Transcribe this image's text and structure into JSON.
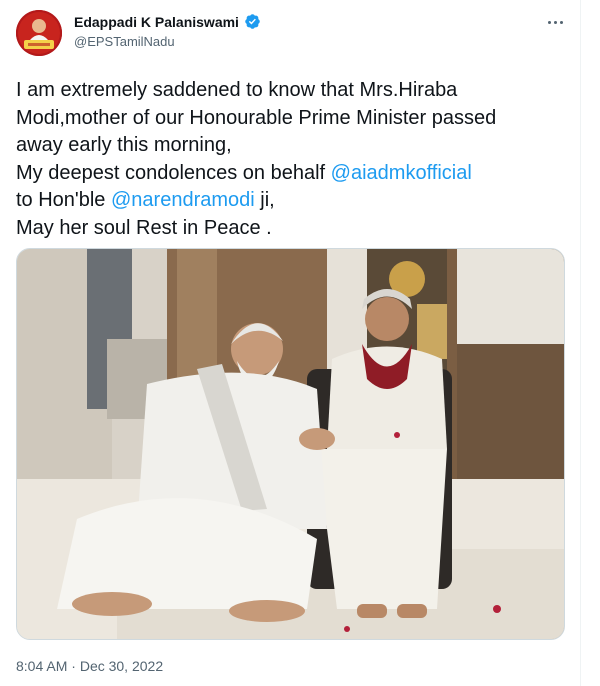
{
  "author": {
    "display_name": "Edappadi K Palaniswami",
    "handle": "@EPSTamilNadu",
    "verified": true,
    "avatar_icon": "profile-avatar"
  },
  "tweet": {
    "line1": "I am extremely saddened to know that Mrs.Hiraba",
    "line2": "Modi,mother of our Honourable Prime Minister passed",
    "line3": "away early this morning,",
    "line4_prefix": "My deepest condolences on behalf ",
    "mention1": "@aiadmkofficial",
    "line5_prefix": "to Hon'ble ",
    "mention2": "@narendramodi",
    "line5_suffix": " ji,",
    "line6": "May her soul Rest in Peace ."
  },
  "meta": {
    "time": "8:04 AM",
    "separator": " · ",
    "date": "Dec 30, 2022"
  },
  "colors": {
    "link": "#1d9bf0",
    "verified": "#1d9bf0",
    "secondary_text": "#536471"
  },
  "icons": {
    "more": "more-icon",
    "verified": "verified-badge-icon"
  }
}
